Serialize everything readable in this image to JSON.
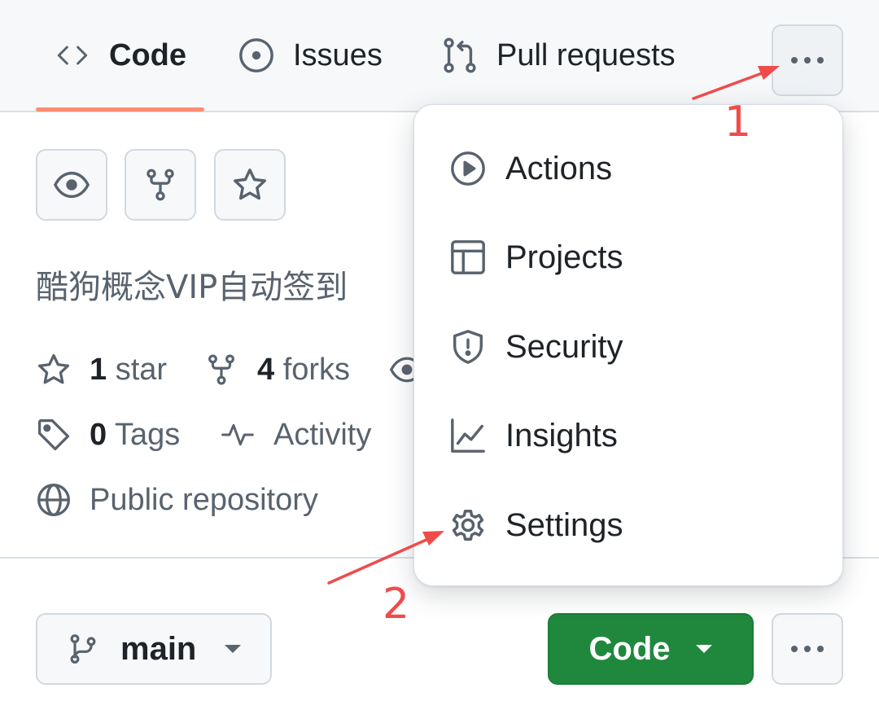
{
  "tabs": {
    "code": "Code",
    "issues": "Issues",
    "pulls": "Pull requests"
  },
  "repo": {
    "description": "酷狗概念VIP自动签到",
    "stars_count": "1",
    "stars_label": "star",
    "forks_count": "4",
    "forks_label": "forks",
    "tags_count": "0",
    "tags_label": "Tags",
    "activity_label": "Activity",
    "visibility": "Public repository"
  },
  "menu": {
    "items": [
      {
        "label": "Actions",
        "icon": "play-icon"
      },
      {
        "label": "Projects",
        "icon": "table-icon"
      },
      {
        "label": "Security",
        "icon": "shield-icon"
      },
      {
        "label": "Insights",
        "icon": "graph-icon"
      },
      {
        "label": "Settings",
        "icon": "gear-icon"
      }
    ]
  },
  "bottom": {
    "branch": "main",
    "code_button": "Code"
  },
  "annotations": {
    "step1": "1",
    "step2": "2"
  },
  "colors": {
    "accent_underline": "#fd8c73",
    "code_button": "#1f883d",
    "annotation_red": "#f04b4b"
  }
}
